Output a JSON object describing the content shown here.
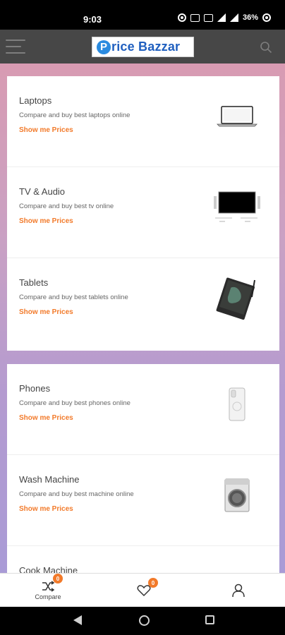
{
  "status_bar": {
    "time": "9:03",
    "battery": "36%"
  },
  "header": {
    "logo_letter": "P",
    "logo_text": "rice Bazzar"
  },
  "categories_group1": [
    {
      "title": "Laptops",
      "description": "Compare and buy best laptops online",
      "link": "Show me Prices",
      "icon": "laptop-icon"
    },
    {
      "title": "TV & Audio",
      "description": "Compare and buy best tv online",
      "link": "Show me Prices",
      "icon": "tv-icon"
    },
    {
      "title": "Tablets",
      "description": "Compare and buy best tablets online",
      "link": "Show me Prices",
      "icon": "tablet-icon"
    }
  ],
  "categories_group2": [
    {
      "title": "Phones",
      "description": "Compare and buy best phones online",
      "link": "Show me Prices",
      "icon": "phone-icon"
    },
    {
      "title": "Wash Machine",
      "description": "Compare and buy best machine online",
      "link": "Show me Prices",
      "icon": "washing-machine-icon"
    },
    {
      "title": "Cook Machine",
      "description": "",
      "link": "",
      "icon": "cooker-icon"
    }
  ],
  "bottom_nav": {
    "compare": {
      "label": "Compare",
      "badge": "0"
    },
    "wishlist": {
      "label": "",
      "badge": "0"
    },
    "account": {
      "label": ""
    }
  },
  "colors": {
    "accent": "#f27a2a",
    "header_bg": "#474747",
    "logo_blue": "#1f5fbf"
  }
}
